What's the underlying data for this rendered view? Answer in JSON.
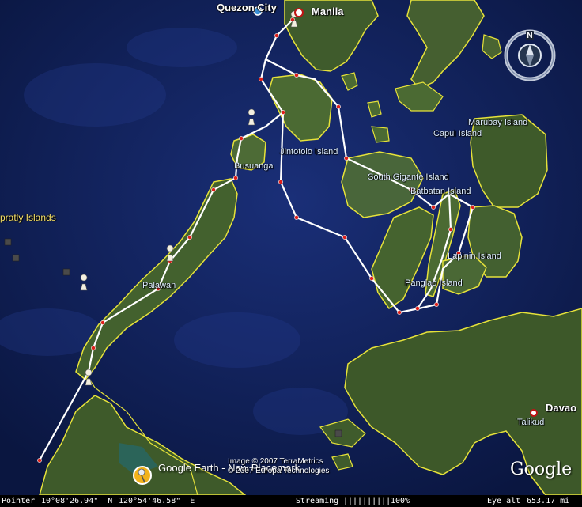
{
  "labels": {
    "quezon_city": "Quezon City",
    "manila": "Manila",
    "marubay_island": "Marubay Island",
    "capul_island": "Capul Island",
    "jintotolo_island": "Jintotolo Island",
    "busuanga": "Busuanga",
    "south_gigante_island": "South Gigante Island",
    "batbatan_island": "Batbatan Island",
    "spratly_islands": "pratly Islands",
    "lapinin_island": "Lapinin Island",
    "palawan": "Palawan",
    "panglao_island": "Panglao Island",
    "davao": "Davao",
    "talikud": "Talikud"
  },
  "placemark": {
    "label": "Google Earth - New Placemark",
    "icon": "pushpin-icon"
  },
  "attribution": {
    "line1": "Image © 2007 TerraMetrics",
    "line2": "© 2007 Europa Technologies"
  },
  "logo": "Google",
  "compass": {
    "north_label": "N",
    "icon": "compass-icon"
  },
  "status": {
    "pointer_label": "Pointer",
    "pointer_lat": "10°08'26.94\"  N",
    "pointer_lon": "120°54'46.58\"  E",
    "streaming_label": "Streaming",
    "streaming_bar": "||||||||||",
    "streaming_pct": "100%",
    "eye_alt_label": "Eye alt",
    "eye_alt_value": "653.17 mi"
  },
  "colors": {
    "ocean": "#0b1a4a",
    "land": "#3d5a2a",
    "coast": "#e6e23a",
    "route": "#ffffff",
    "waypoint": "#e0201a"
  }
}
